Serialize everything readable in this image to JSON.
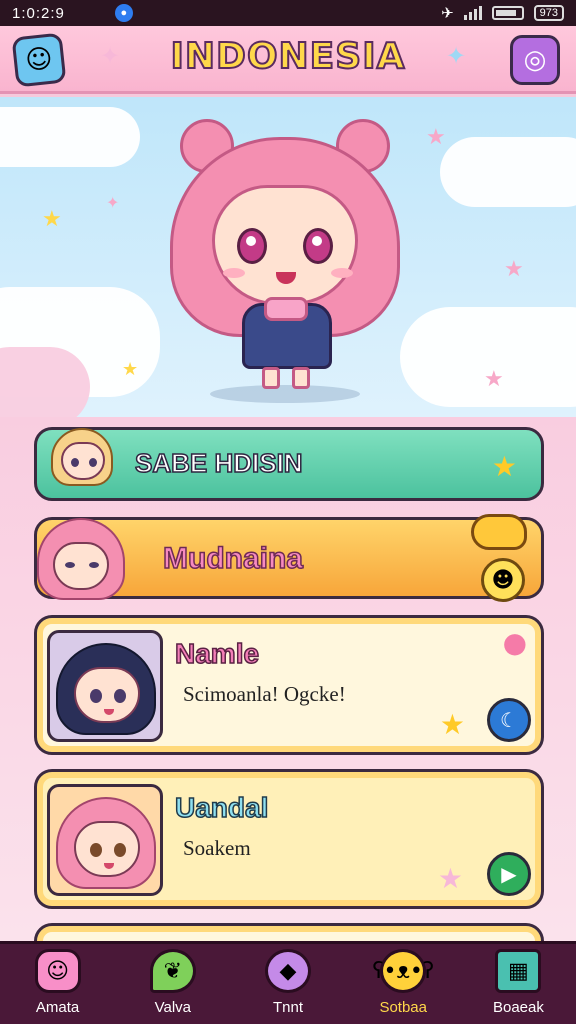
{
  "status_bar": {
    "time": "1:0:2:9",
    "battery_text": "973"
  },
  "header": {
    "title": "INDONESIA",
    "left_icon": "smile-star-icon",
    "right_icon": "target-icon"
  },
  "list": {
    "banner_green": {
      "label": "SABE HDISIN"
    },
    "banner_orange": {
      "label": "Mudnaina"
    },
    "cards": [
      {
        "title": "Namle",
        "subtitle": "Scimoanla! Ogcke!"
      },
      {
        "title": "Uandal",
        "subtitle": "Soakem"
      }
    ]
  },
  "nav": {
    "items": [
      {
        "label": "Amata",
        "icon": "pink-creature-icon",
        "color": "#f88fc8"
      },
      {
        "label": "Valva",
        "icon": "leaf-icon",
        "color": "#7fd05a"
      },
      {
        "label": "Tnnt",
        "icon": "gem-icon",
        "color": "#c48ae8"
      },
      {
        "label": "Sotbaa",
        "icon": "bear-icon",
        "color": "#ffd13a",
        "active": true
      },
      {
        "label": "Boaeak",
        "icon": "grid-icon",
        "color": "#4ac0b0"
      }
    ]
  },
  "colors": {
    "accent": "#ffd84a",
    "header_bg": "#f9b4cf",
    "nav_bg": "#4a1838"
  }
}
